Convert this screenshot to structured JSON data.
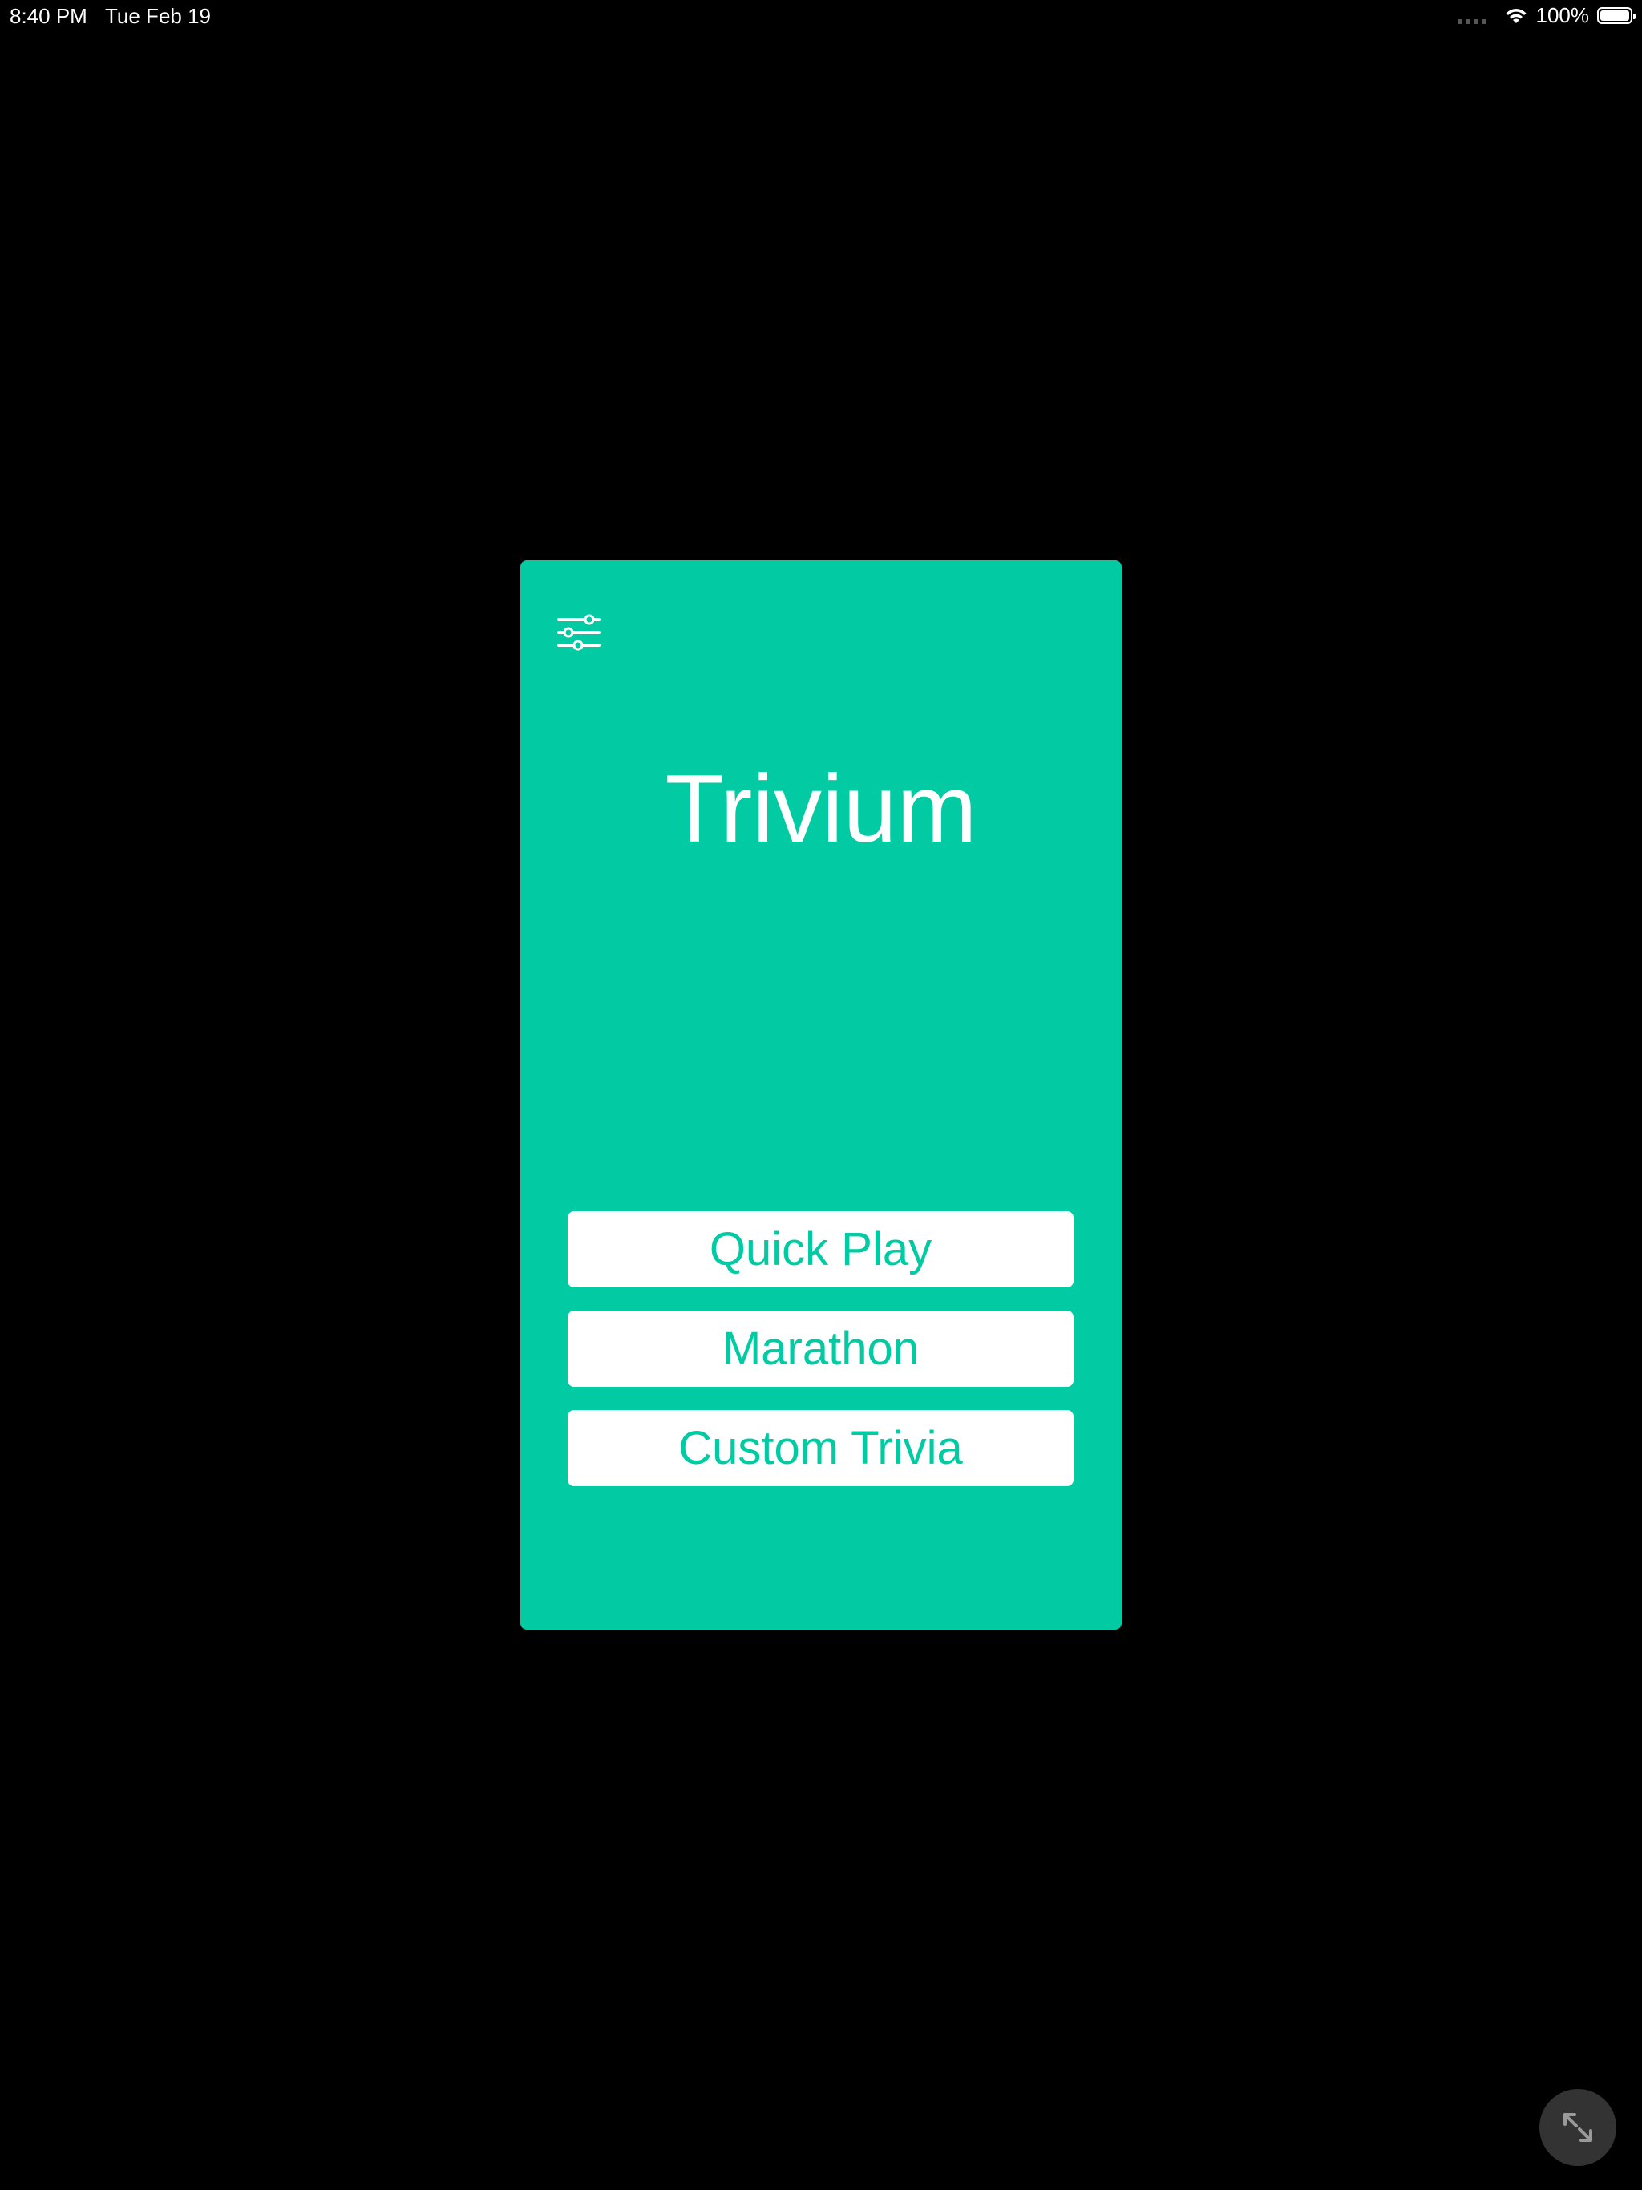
{
  "status_bar": {
    "time": "8:40 PM",
    "date": "Tue Feb 19",
    "battery_percent": "100%",
    "wifi_icon": "wifi-icon",
    "battery_icon": "battery-full-icon"
  },
  "app": {
    "title": "Trivium",
    "background_color": "#02cba3",
    "settings_icon": "sliders-icon",
    "menu": {
      "quick_play": "Quick Play",
      "marathon": "Marathon",
      "custom_trivia": "Custom Trivia"
    }
  },
  "overlay": {
    "expand_icon": "expand-arrows-icon"
  }
}
